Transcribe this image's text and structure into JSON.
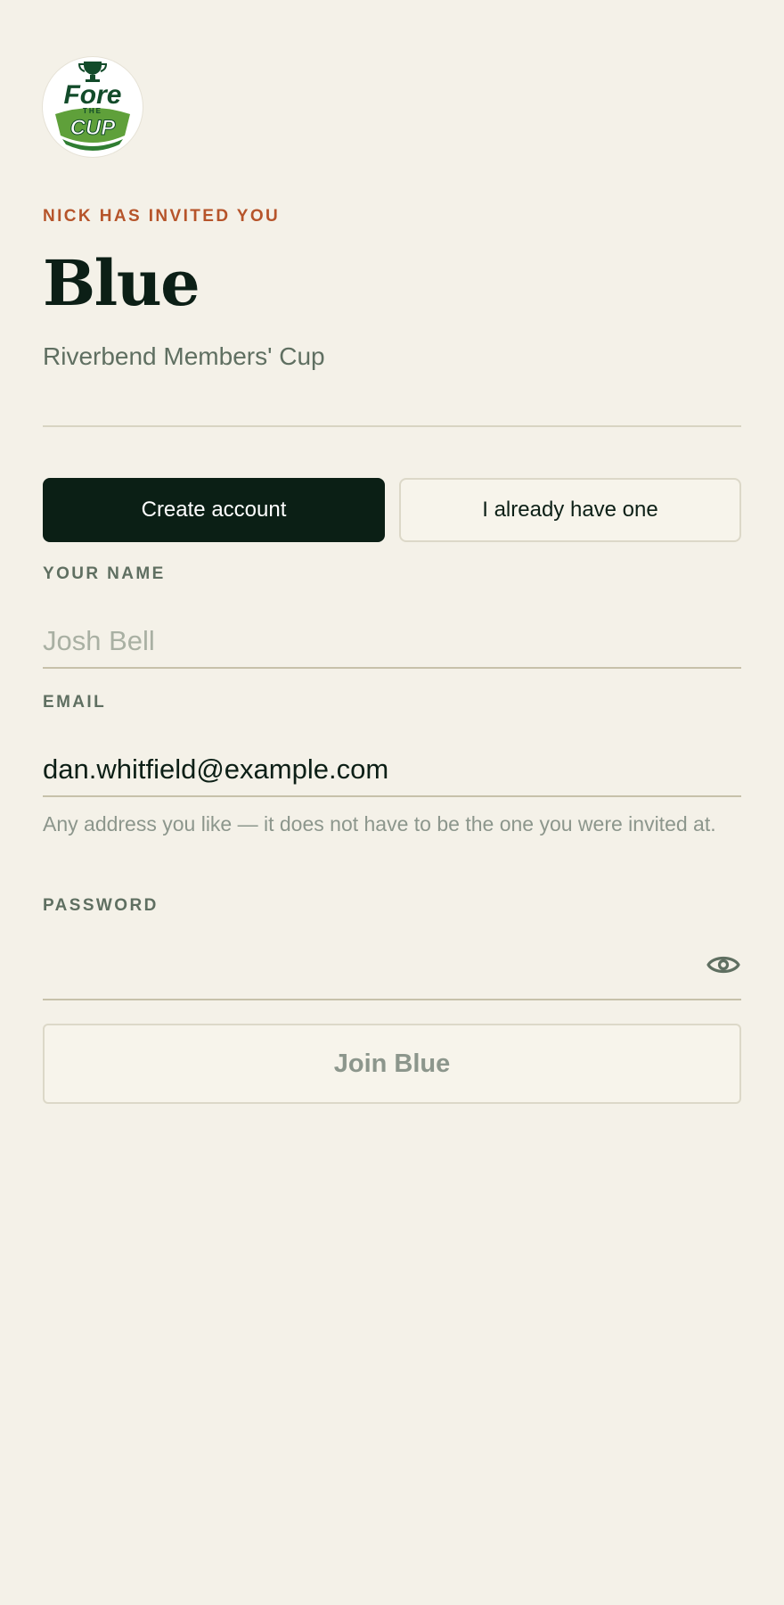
{
  "brand": {
    "logo_icon": "fore-the-cup-logo",
    "logo_text_top": "Fore",
    "logo_text_mid": "THE",
    "logo_text_bottom": "CUP",
    "colors": {
      "dark_green": "#124b2a",
      "light_green": "#5fa03a"
    }
  },
  "invite": {
    "eyebrow": "NICK HAS INVITED YOU",
    "team_name": "Blue",
    "event_name": "Riverbend Members' Cup"
  },
  "mode_toggle": {
    "create_label": "Create account",
    "existing_label": "I already have one",
    "selected": "create"
  },
  "form": {
    "name": {
      "label": "YOUR NAME",
      "placeholder": "Josh Bell",
      "value": ""
    },
    "email": {
      "label": "EMAIL",
      "value": "dan.whitfield@example.com",
      "hint": "Any address you like — it does not have to be the one you were invited at."
    },
    "password": {
      "label": "PASSWORD",
      "value": "",
      "toggle_icon": "eye-icon"
    },
    "submit_label": "Join Blue"
  },
  "colors": {
    "background": "#f4f1e8",
    "accent": "#b6542a",
    "primary_dark": "#0b1f15",
    "muted_text": "#5f6f61"
  }
}
